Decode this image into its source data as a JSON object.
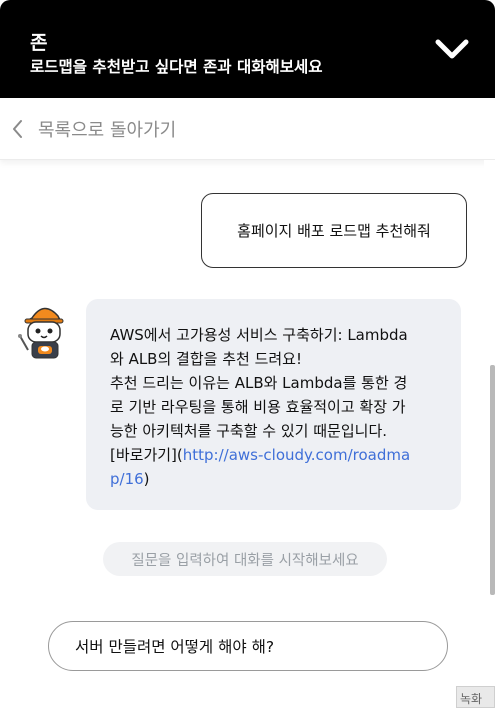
{
  "header": {
    "name": "존",
    "subtitle": "로드맵을 추천받고 싶다면 존과 대화해보세요",
    "toggle_icon": "chevron-down-icon"
  },
  "nav": {
    "back_label": "목록으로 돌아가기",
    "back_icon": "chevron-left-icon"
  },
  "messages": {
    "user": "홈페이지 배포 로드맵 추천해줘",
    "bot": {
      "line1": "AWS에서 고가용성 서비스 구축하기: Lambda",
      "line2": "와 ALB의 결합을 추천 드려요!",
      "line3": "추천 드리는 이유는 ALB와 Lambda를 통한 경",
      "line4": "로 기반 라우팅을 통해 비용 효율적이고 확장 가",
      "line5": "능한 아키텍처를 구축할 수 있기 때문입니다.",
      "link_prefix": "[바로가기](",
      "link_part1": "http://aws-cloudy.com/roadma",
      "link_part2": "p/16",
      "link_suffix": ")"
    }
  },
  "hint": "질문을 입력하여 대화를 시작해보세요",
  "input": {
    "value": "서버 만들려면 어떻게 해야 해?"
  },
  "corner_label": "녹화",
  "colors": {
    "header_bg": "#000000",
    "bot_bubble_bg": "#eef0f4",
    "link": "#3f6fd8"
  }
}
